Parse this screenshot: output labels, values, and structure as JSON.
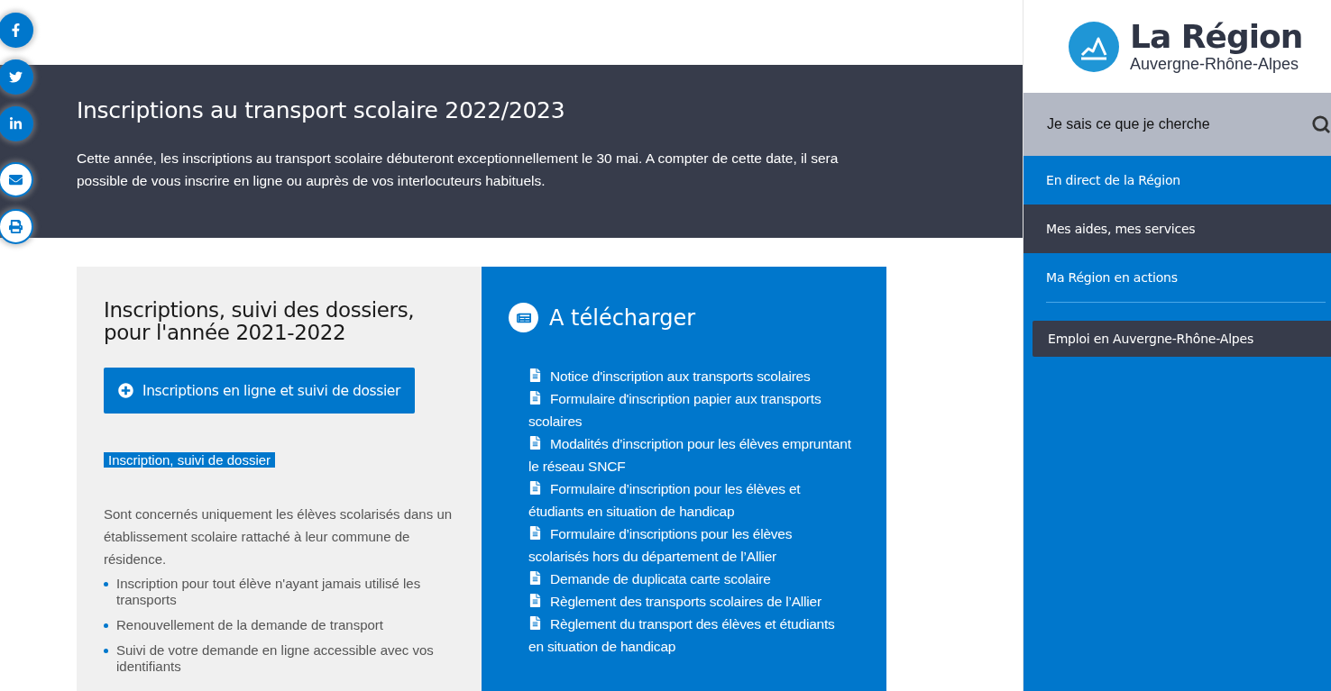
{
  "share_bar": [
    {
      "kind": "filled"
    },
    {
      "kind": "filled"
    },
    {
      "kind": "filled"
    },
    {
      "kind": "outline"
    },
    {
      "kind": "outline"
    }
  ],
  "banner": {
    "title": "Inscriptions au transport scolaire 2022/2023",
    "text": "Cette année, les inscriptions au transport scolaire débuteront exceptionnellement le 30 mai. A compter de cette date, il sera possible de vous inscrire en ligne ou auprès de vos interlocuteurs habituels."
  },
  "registration": {
    "title": "Inscriptions, suivi des dossiers, pour l'année 2021-2022",
    "button": "Inscriptions en ligne et suivi de dossier",
    "highlight": "Inscription, suivi de dossier",
    "intro": "Sont concernés uniquement les élèves scolarisés dans un établissement scolaire rattaché à leur commune de résidence.",
    "bullets": [
      "Inscription pour tout élève n'ayant jamais utilisé les transports",
      "Renouvellement de la demande de transport",
      "Suivi de votre demande en ligne accessible avec vos identifiants"
    ]
  },
  "downloads": {
    "title": "A télécharger",
    "items": [
      "Notice d'inscription aux transports scolaires",
      "Formulaire d'inscription papier aux transports scolaires",
      "Modalités d’inscription pour les élèves empruntant le réseau SNCF",
      "Formulaire d’inscription pour les élèves et étudiants en situation de handicap",
      "Formulaire d’inscriptions pour les élèves scolarisés hors du département de l’Allier",
      "Demande de duplicata carte scolaire",
      "Règlement des transports scolaires de l’Allier",
      "Règlement du transport des élèves et étudiants en situation de handicap"
    ]
  },
  "sidebar": {
    "logo": {
      "title": "La Région",
      "subtitle": "Auvergne-Rhône-Alpes"
    },
    "search": {
      "placeholder": "Je sais ce que je cherche"
    },
    "nav": [
      {
        "label": "En direct de la Région",
        "selected": false
      },
      {
        "label": "Mes aides, mes services",
        "selected": true
      },
      {
        "label": "Ma Région en actions",
        "selected": false
      }
    ],
    "featured_link": "Emploi en Auvergne-Rhône-Alpes"
  }
}
